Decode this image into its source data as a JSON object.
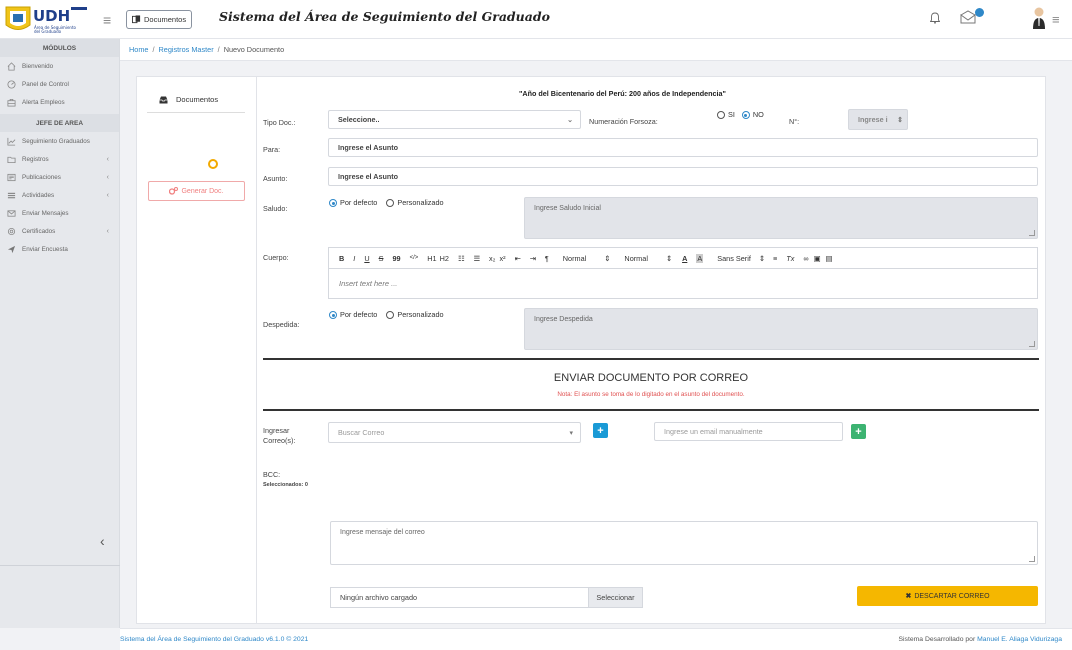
{
  "header": {
    "logo_text": "UDH",
    "logo_sub": "Área de Seguimiento del Graduado",
    "docs_button": "Documentos",
    "title": "Sistema del Área de Seguimiento del Graduado"
  },
  "sidebar": {
    "modules_heading": "MÓDULOS",
    "items_top": [
      {
        "label": "Bienvenido",
        "icon": "home-icon"
      },
      {
        "label": "Panel de Control",
        "icon": "dashboard-icon"
      },
      {
        "label": "Alerta Empleos",
        "icon": "briefcase-icon"
      }
    ],
    "role_heading": "JEFE DE AREA",
    "items_role": [
      {
        "label": "Seguimiento Graduados",
        "icon": "chart-icon",
        "chevron": false
      },
      {
        "label": "Registros",
        "icon": "folder-icon",
        "chevron": true
      },
      {
        "label": "Publicaciones",
        "icon": "newspaper-icon",
        "chevron": true
      },
      {
        "label": "Actividades",
        "icon": "list-icon",
        "chevron": true
      },
      {
        "label": "Enviar Mensajes",
        "icon": "envelope-icon",
        "chevron": false
      },
      {
        "label": "Certificados",
        "icon": "certificate-icon",
        "chevron": true
      },
      {
        "label": "Enviar Encuesta",
        "icon": "send-icon",
        "chevron": false
      }
    ],
    "collapse_glyph": "‹"
  },
  "breadcrumb": {
    "home": "Home",
    "registros": "Registros Master",
    "current": "Nuevo Documento",
    "separator": "/"
  },
  "left_panel": {
    "tab_label": "Documentos",
    "generate_button": "Generar Doc."
  },
  "form": {
    "banner": "\"Año del Bicentenario del Perú: 200 años de Independencia\"",
    "tipo_doc_label": "Tipo Doc.:",
    "tipo_doc_value": "Seleccione..",
    "numeracion_label": "Numeración Forsoza:",
    "si_label": "SI",
    "no_label": "NO",
    "numero_label": "N°:",
    "numero_placeholder": "Ingrese i",
    "para_label": "Para:",
    "para_value": "Ingrese el Asunto",
    "asunto_label": "Asunto:",
    "asunto_value": "Ingrese el Asunto",
    "saludo_label": "Saludo:",
    "por_defecto": "Por defecto",
    "personalizado": "Personalizado",
    "saludo_placeholder": "Ingrese Saludo Inicial",
    "cuerpo_label": "Cuerpo:",
    "editor_placeholder": "Insert text here ...",
    "toolbar": {
      "bold": "B",
      "italic": "I",
      "underline": "U",
      "strike": "S",
      "quote": "99",
      "code": "</>",
      "h1": "H1",
      "h2": "H2",
      "ol": "☷",
      "ul": "☰",
      "sub": "x₂",
      "sup": "x²",
      "outdent": "⇤",
      "indent": "⇥",
      "rtl": "¶",
      "size1": "Normal",
      "size2": "Normal",
      "font": "Sans Serif",
      "align": "≡",
      "clean": "Tx"
    },
    "despedida_label": "Despedida:",
    "despedida_placeholder": "Ingrese Despedida"
  },
  "email": {
    "title": "ENVIAR DOCUMENTO POR CORREO",
    "note": "Nota: El asunto se toma de lo digitado en el asunto del documento.",
    "ingresar_label": "Ingresar Correo(s):",
    "buscar_placeholder": "Buscar Correo",
    "manual_placeholder": "Ingrese un email manualmente",
    "bcc_label": "BCC:",
    "seleccionados": "Seleccionados: 0",
    "mensaje_placeholder": "Ingrese mensaje del correo",
    "file_text": "Ningún archivo cargado",
    "file_button": "Seleccionar",
    "discard_button": "DESCARTAR CORREO"
  },
  "footer": {
    "left": "Sistema del Área de Seguimiento del Graduado v6.1.0 © 2021",
    "right_prefix": "Sistema Desarrollado por",
    "right_author": "Manuel E. Aliaga Vidurizaga"
  },
  "colors": {
    "accent": "#2f88c8",
    "discard": "#f5b700",
    "add_button_blue": "#1a9ad6",
    "add_button_green": "#3cb371"
  }
}
